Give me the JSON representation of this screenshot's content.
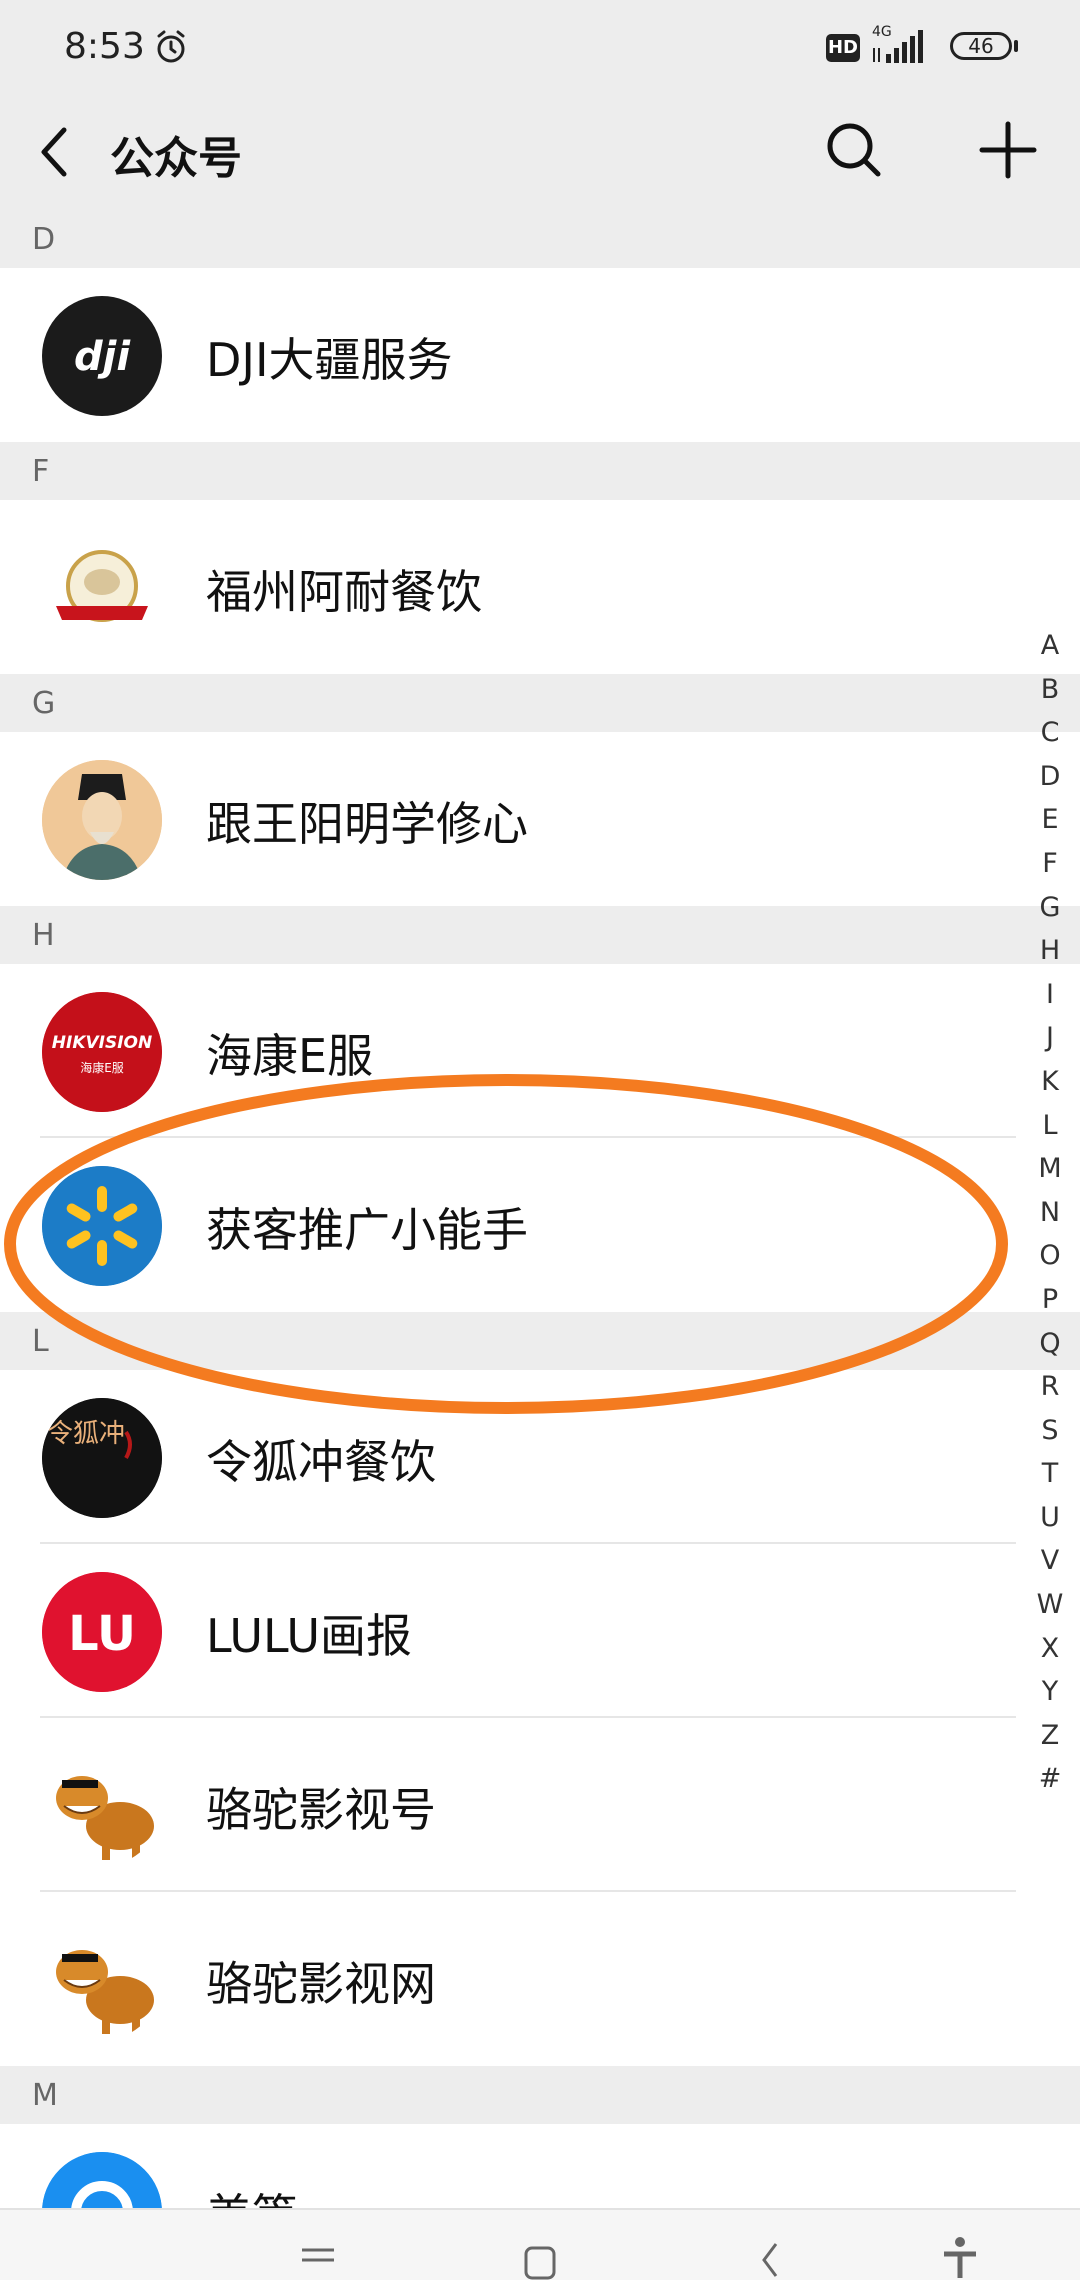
{
  "status_bar": {
    "time": "8:53",
    "hd_badge": "HD",
    "network": "4G",
    "battery": "46"
  },
  "header": {
    "back_icon": "chevron-left-icon",
    "title": "公众号",
    "search_icon": "search-icon",
    "add_icon": "plus-icon"
  },
  "sections": [
    {
      "letter": "D",
      "items": [
        {
          "name": "DJI大疆服务",
          "avatar": "dji-logo"
        }
      ]
    },
    {
      "letter": "F",
      "items": [
        {
          "name": "福州阿耐餐饮",
          "avatar": "anai-logo"
        }
      ]
    },
    {
      "letter": "G",
      "items": [
        {
          "name": "跟王阳明学修心",
          "avatar": "portrait"
        }
      ]
    },
    {
      "letter": "H",
      "items": [
        {
          "name": "海康E服",
          "avatar": "hikvision-logo",
          "avatar_text": "HIKVISION",
          "avatar_subtext": "海康E服"
        },
        {
          "name": "获客推广小能手",
          "avatar": "spark-logo"
        }
      ]
    },
    {
      "letter": "L",
      "items": [
        {
          "name": "令狐冲餐饮",
          "avatar": "linghuchong-logo",
          "avatar_text": "令狐冲"
        },
        {
          "name": "LULU画报",
          "avatar": "lulu-logo",
          "avatar_text": "LU"
        },
        {
          "name": "骆驼影视号",
          "avatar": "camel-cartoon"
        },
        {
          "name": "骆驼影视网",
          "avatar": "camel-cartoon"
        }
      ]
    },
    {
      "letter": "M",
      "items": [
        {
          "name": "美篇",
          "avatar": "meipian-logo"
        }
      ]
    }
  ],
  "index_letters": [
    "A",
    "B",
    "C",
    "D",
    "E",
    "F",
    "G",
    "H",
    "I",
    "J",
    "K",
    "L",
    "M",
    "N",
    "O",
    "P",
    "Q",
    "R",
    "S",
    "T",
    "U",
    "V",
    "W",
    "X",
    "Y",
    "Z",
    "#"
  ],
  "colors": {
    "background": "#ededed",
    "row": "#ffffff",
    "highlight_ring": "#f47b20",
    "hikvision_red": "#d0121b",
    "lulu_red": "#e0122f",
    "spark_blue": "#1c7cc7",
    "spark_yellow": "#ffc220"
  },
  "nav_bar": [
    "menu-icon",
    "home-icon",
    "back-icon",
    "accessibility-icon"
  ]
}
